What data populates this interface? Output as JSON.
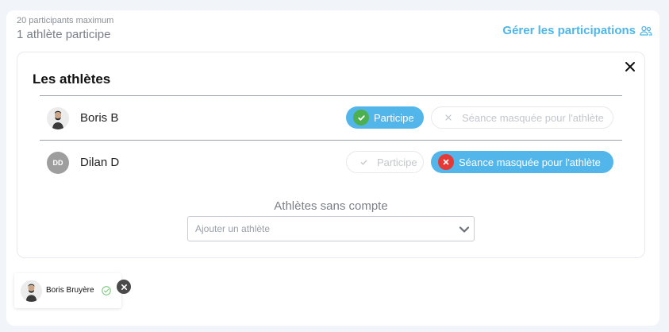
{
  "summary": {
    "max_label": "20 participants maximum",
    "count_label": "1 athlète participe",
    "manage_label": "Gérer les participations"
  },
  "panel": {
    "title": "Les athlètes",
    "rows": [
      {
        "name": "Boris B",
        "avatar": "photo",
        "initials": "",
        "participe_label": "Participe",
        "participe_active": true,
        "masque_label": "Séance masquée pour l'athlète",
        "masque_active": false
      },
      {
        "name": "Dilan D",
        "avatar": "initials",
        "initials": "DD",
        "participe_label": "Participe",
        "participe_active": false,
        "masque_label": "Séance masquée pour l'athlète",
        "masque_active": true
      }
    ],
    "no_account_label": "Athlètes sans compte",
    "add_placeholder": "Ajouter un athlète"
  },
  "chip": {
    "name": "Boris Bruyère",
    "status_icon": "check-outline-icon"
  },
  "colors": {
    "accent": "#52b6ea",
    "link": "#4fb6e8",
    "success": "#4caf50",
    "danger": "#e53935"
  }
}
